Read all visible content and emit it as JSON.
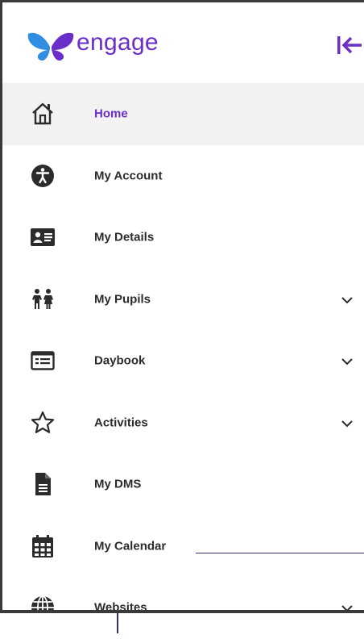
{
  "brand": {
    "name": "engage",
    "logo": "butterfly-logo",
    "colors": {
      "brand_purple": "#6a2fc8",
      "logo_blue": "#2f8ee0",
      "logo_purple": "#6a2fc8"
    }
  },
  "header": {
    "collapse_icon": "collapse-left-icon"
  },
  "nav": {
    "items": [
      {
        "label": "Home",
        "icon": "home-icon",
        "active": true,
        "expandable": false
      },
      {
        "label": "My Account",
        "icon": "accessibility-icon",
        "active": false,
        "expandable": false
      },
      {
        "label": "My Details",
        "icon": "id-card-icon",
        "active": false,
        "expandable": false
      },
      {
        "label": "My Pupils",
        "icon": "children-icon",
        "active": false,
        "expandable": true
      },
      {
        "label": "Daybook",
        "icon": "daybook-icon",
        "active": false,
        "expandable": true
      },
      {
        "label": "Activities",
        "icon": "star-icon",
        "active": false,
        "expandable": true
      },
      {
        "label": "My DMS",
        "icon": "document-icon",
        "active": false,
        "expandable": false
      },
      {
        "label": "My Calendar",
        "icon": "calendar-icon",
        "active": false,
        "expandable": false
      },
      {
        "label": "Websites",
        "icon": "globe-icon",
        "active": false,
        "expandable": true
      }
    ]
  },
  "colors": {
    "active_background": "#f3f2f2",
    "text": "#2b2b2b",
    "frame": "#3a3a3a",
    "annotation_line": "#36306b"
  }
}
